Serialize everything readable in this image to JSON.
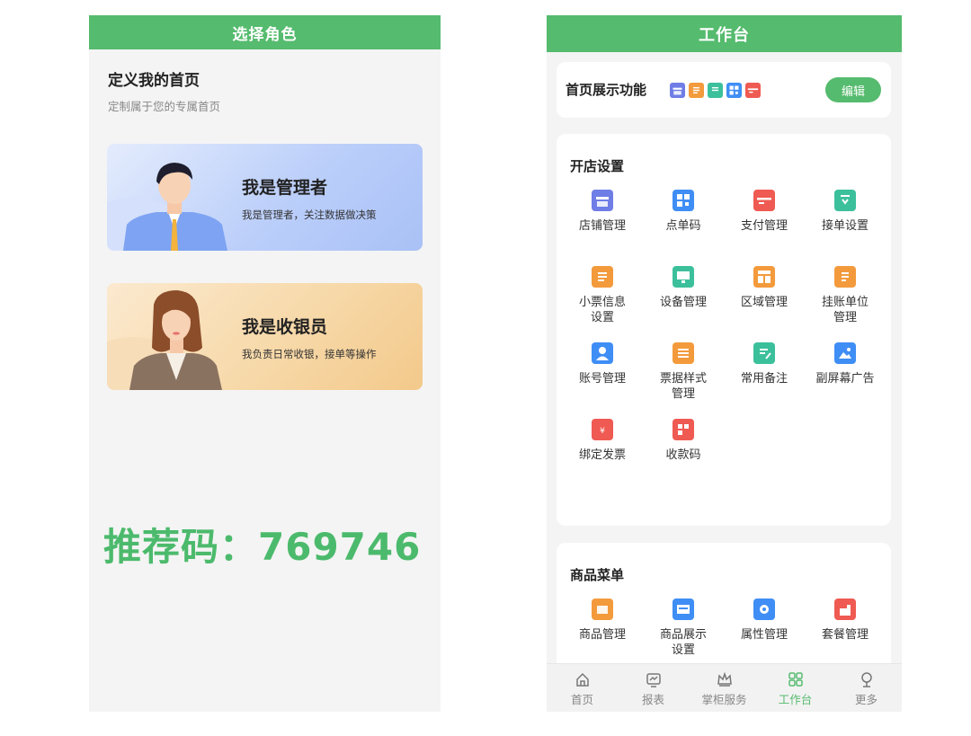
{
  "left": {
    "header_title": "选择角色",
    "heading": "定义我的首页",
    "subheading": "定制属于您的专属首页",
    "roles": [
      {
        "title": "我是管理者",
        "desc": "我是管理者，关注数据做决策"
      },
      {
        "title": "我是收银员",
        "desc": "我负责日常收银，接单等操作"
      }
    ],
    "promo_text": "推荐码：769746"
  },
  "right": {
    "header_title": "工作台",
    "feature_label": "首页展示功能",
    "feature_icons": [
      "store-icon",
      "receipt-icon",
      "document-icon",
      "qr-code-icon",
      "payment-card-icon"
    ],
    "edit_label": "编辑",
    "sections": [
      {
        "title": "开店设置",
        "items": [
          {
            "label": "店铺管理",
            "icon": "store-icon",
            "color": "#6f7de6"
          },
          {
            "label": "点单码",
            "icon": "qr-code-icon",
            "color": "#3f8ef5"
          },
          {
            "label": "支付管理",
            "icon": "payment-card-icon",
            "color": "#ef5a52"
          },
          {
            "label": "接单设置",
            "icon": "order-setting-icon",
            "color": "#3cc09c"
          },
          {
            "label": "小票信息\n设置",
            "icon": "receipt-icon",
            "color": "#f39a3c"
          },
          {
            "label": "设备管理",
            "icon": "device-icon",
            "color": "#3cc09c"
          },
          {
            "label": "区域管理",
            "icon": "area-icon",
            "color": "#f39a3c"
          },
          {
            "label": "挂账单位\n管理",
            "icon": "credit-unit-icon",
            "color": "#f39a3c"
          },
          {
            "label": "账号管理",
            "icon": "account-icon",
            "color": "#3f8ef5"
          },
          {
            "label": "票据样式\n管理",
            "icon": "ticket-style-icon",
            "color": "#f39a3c"
          },
          {
            "label": "常用备注",
            "icon": "note-icon",
            "color": "#3cc09c"
          },
          {
            "label": "副屏幕广告",
            "icon": "screen-ad-icon",
            "color": "#3f8ef5"
          },
          {
            "label": "绑定发票",
            "icon": "invoice-icon",
            "color": "#ef5a52"
          },
          {
            "label": "收款码",
            "icon": "payment-qr-icon",
            "color": "#ef5a52"
          }
        ]
      },
      {
        "title": "商品菜单",
        "items": [
          {
            "label": "商品管理",
            "icon": "goods-icon",
            "color": "#f39a3c"
          },
          {
            "label": "商品展示\n设置",
            "icon": "display-icon",
            "color": "#3f8ef5"
          },
          {
            "label": "属性管理",
            "icon": "attribute-icon",
            "color": "#3f8ef5"
          },
          {
            "label": "套餐管理",
            "icon": "combo-meal-icon",
            "color": "#ef5a52"
          }
        ]
      }
    ],
    "tabs": [
      {
        "label": "首页",
        "icon": "home-icon",
        "active": false
      },
      {
        "label": "报表",
        "icon": "report-icon",
        "active": false
      },
      {
        "label": "掌柜服务",
        "icon": "crown-icon",
        "active": false
      },
      {
        "label": "工作台",
        "icon": "grid-icon",
        "active": true
      },
      {
        "label": "更多",
        "icon": "more-icon",
        "active": false
      }
    ],
    "accent_color": "#55bb6e"
  }
}
